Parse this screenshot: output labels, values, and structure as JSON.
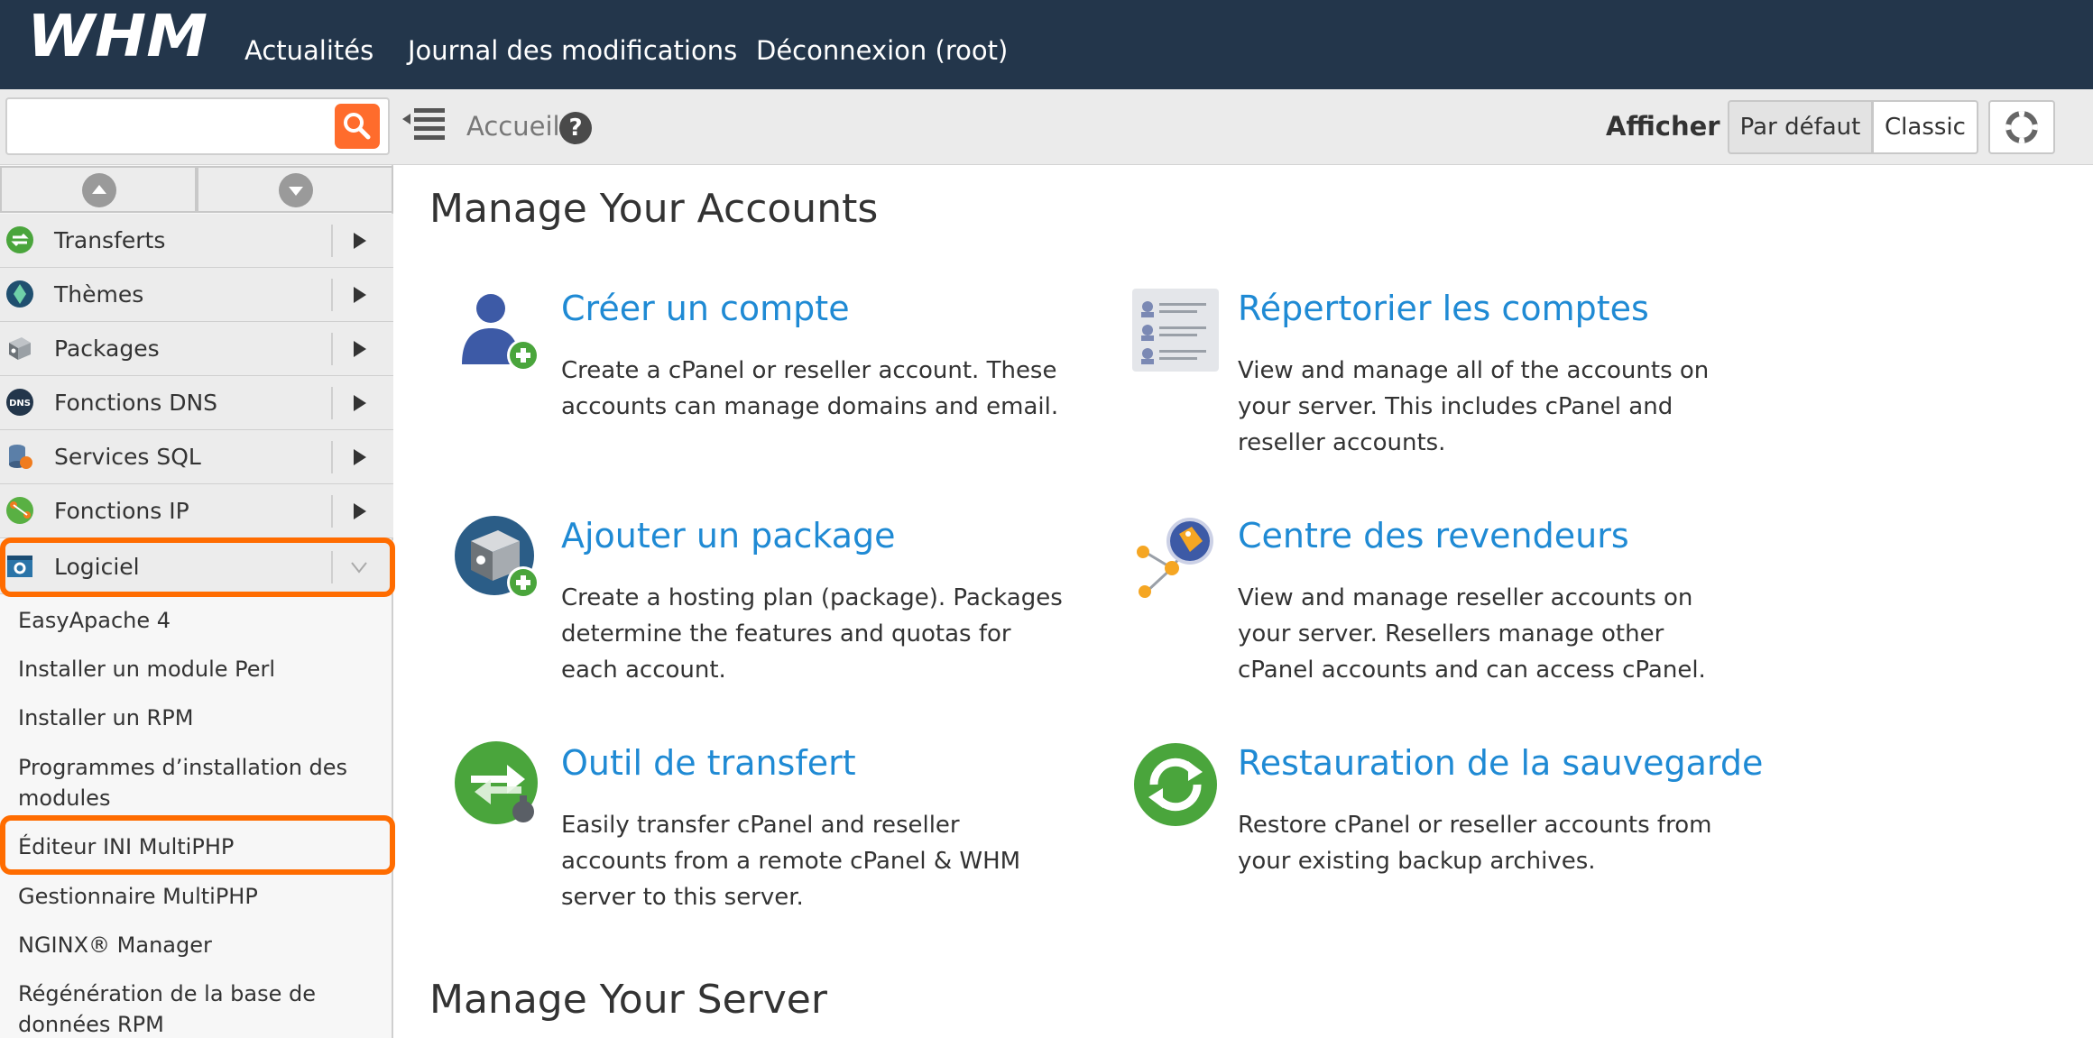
{
  "topbar": {
    "logo_text": "WHM",
    "nav": [
      "Actualités",
      "Journal des modifications",
      "Déconnexion (root)"
    ]
  },
  "subbar": {
    "search_value": "",
    "breadcrumb": "Accueil",
    "help": "?",
    "view_label": "Afficher :",
    "view_default": "Par défaut",
    "view_classic": "Classic"
  },
  "sidebar": {
    "categories": [
      {
        "label": "Transferts",
        "icon": "transfer-icon"
      },
      {
        "label": "Thèmes",
        "icon": "themes-icon"
      },
      {
        "label": "Packages",
        "icon": "packages-icon"
      },
      {
        "label": "Fonctions DNS",
        "icon": "dns-icon"
      },
      {
        "label": "Services SQL",
        "icon": "sql-icon"
      },
      {
        "label": "Fonctions IP",
        "icon": "ip-icon"
      },
      {
        "label": "Logiciel",
        "icon": "software-icon",
        "expanded": true
      }
    ],
    "dns_icon_text": "DNS",
    "subitems": [
      "EasyApache 4",
      "Installer un module Perl",
      "Installer un RPM",
      "Programmes d’installation des modules",
      "Éditeur INI MultiPHP",
      "Gestionnaire MultiPHP",
      "NGINX® Manager",
      "Régénération de la base de données RPM"
    ]
  },
  "main": {
    "section1": "Manage Your Accounts",
    "section2": "Manage Your Server",
    "tiles": [
      {
        "title": "Créer un compte",
        "desc": "Create a cPanel or reseller account. These accounts can manage domains and email."
      },
      {
        "title": "Répertorier les comptes",
        "desc": "View and manage all of the accounts on your server. This includes cPanel and reseller accounts."
      },
      {
        "title": "Ajouter un package",
        "desc": "Create a hosting plan (package). Packages determine the features and quotas for each account."
      },
      {
        "title": "Centre des revendeurs",
        "desc": "View and manage reseller accounts on your server. Resellers manage other cPanel accounts and can access cPanel."
      },
      {
        "title": "Outil de transfert",
        "desc": "Easily transfer cPanel and reseller accounts from a remote cPanel & WHM server to this server."
      },
      {
        "title": "Restauration de la sauvegarde",
        "desc": "Restore cPanel or reseller accounts from your existing backup archives."
      }
    ]
  },
  "colors": {
    "topbar": "#23364b",
    "accent_orange": "#ff6c2c",
    "highlight": "#ff6c00",
    "link_blue": "#1f8ad4"
  }
}
